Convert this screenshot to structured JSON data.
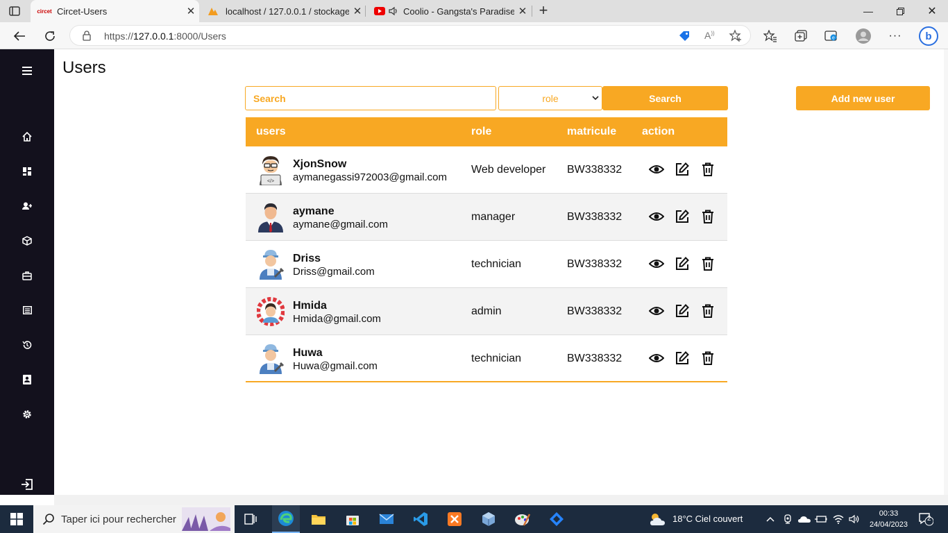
{
  "browser": {
    "tabs": [
      {
        "title": "Circet-Users",
        "favicon": "circet-logo",
        "active": true
      },
      {
        "title": "localhost / 127.0.0.1 / stockage /",
        "favicon": "phpmyadmin-logo",
        "active": false
      },
      {
        "title": "Coolio - Gangsta's Paradise",
        "favicon": "youtube-logo",
        "active": false
      }
    ],
    "url_prefix": "https://",
    "url_host": "127.0.0.1",
    "url_rest": ":8000/Users"
  },
  "page": {
    "title": "Users"
  },
  "search": {
    "placeholder": "Search",
    "role_selected": "role",
    "button_label": "Search",
    "add_button_label": "Add new user"
  },
  "table": {
    "headers": [
      "users",
      "role",
      "matricule",
      "action"
    ],
    "rows": [
      {
        "name": "XjonSnow",
        "email": "aymanegassi972003@gmail.com",
        "role": "Web developer",
        "matricule": "BW338332",
        "avatar": "developer-avatar"
      },
      {
        "name": "aymane",
        "email": "aymane@gmail.com",
        "role": "manager",
        "matricule": "BW338332",
        "avatar": "manager-avatar"
      },
      {
        "name": "Driss",
        "email": "Driss@gmail.com",
        "role": "technician",
        "matricule": "BW338332",
        "avatar": "technician-avatar"
      },
      {
        "name": "Hmida",
        "email": "Hmida@gmail.com",
        "role": "admin",
        "matricule": "BW338332",
        "avatar": "admin-avatar"
      },
      {
        "name": "Huwa",
        "email": "Huwa@gmail.com",
        "role": "technician",
        "matricule": "BW338332",
        "avatar": "technician-avatar"
      }
    ]
  },
  "sidebar": {
    "icons": [
      "menu-icon",
      "home-icon",
      "dashboard-icon",
      "add-user-icon",
      "box-icon",
      "briefcase-icon",
      "list-icon",
      "history-icon",
      "contact-card-icon",
      "settings-icon",
      "logout-icon"
    ]
  },
  "taskbar": {
    "search_placeholder": "Taper ici pour rechercher",
    "weather": "18°C  Ciel couvert",
    "time": "00:33",
    "date": "24/04/2023",
    "notifications": "2"
  },
  "colors": {
    "accent": "#f8a823",
    "sidebar_bg": "#13111d"
  }
}
